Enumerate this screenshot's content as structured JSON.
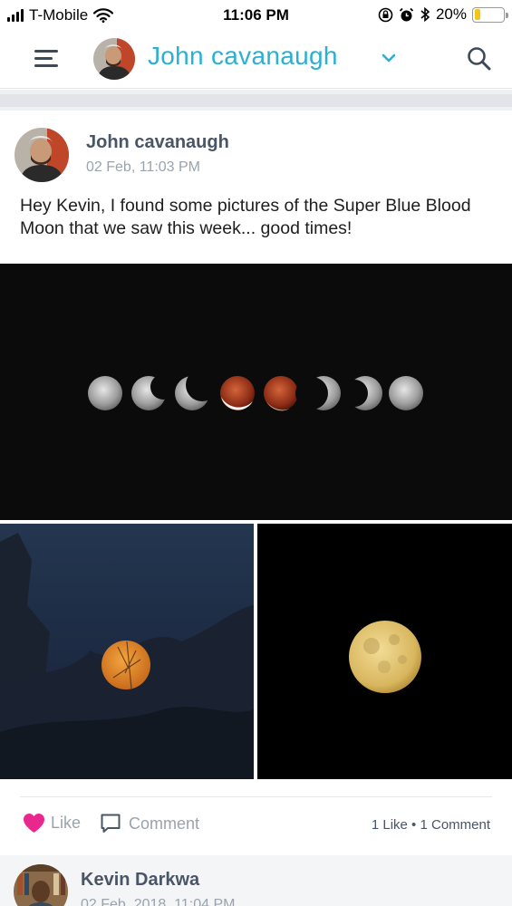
{
  "status_bar": {
    "carrier": "T-Mobile",
    "time": "11:06 PM",
    "battery_percent": "20%",
    "battery_level": 0.2,
    "icons": [
      "signal-icon",
      "wifi-icon",
      "screen-lock-icon",
      "alarm-icon",
      "bluetooth-icon",
      "battery-icon"
    ]
  },
  "header": {
    "user_name": "John cavanaugh",
    "icons": [
      "menu-icon",
      "chevron-down-icon",
      "search-icon"
    ]
  },
  "post": {
    "author": "John cavanaugh",
    "timestamp": "02 Feb, 11:03 PM",
    "text": "Hey Kevin, I found some pictures of the Super Blue Blood Moon that we saw this week... good times!",
    "like_label": "Like",
    "comment_label": "Comment",
    "stats": "1 Like • 1 Comment",
    "colors": {
      "accent": "#29b0d3",
      "like": "#e9278c"
    }
  },
  "comment": {
    "author": "Kevin Darkwa",
    "timestamp": "02 Feb, 2018, 11:04 PM"
  }
}
